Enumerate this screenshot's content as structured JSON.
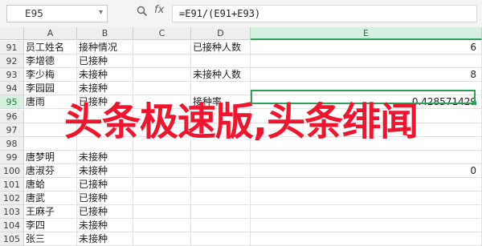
{
  "formula_bar": {
    "name_box": "E95",
    "formula": "=E91/(E91+E93)",
    "icons": [
      "zoom-icon",
      "fx-icon"
    ]
  },
  "columns": [
    "A",
    "B",
    "C",
    "D",
    "E"
  ],
  "rows": [
    {
      "num": "91",
      "a": "员工姓名",
      "b": "接种情况",
      "c": "",
      "d": "已接种人数",
      "e": "6"
    },
    {
      "num": "92",
      "a": "李增德",
      "b": "已接种",
      "c": "",
      "d": "",
      "e": ""
    },
    {
      "num": "93",
      "a": "李少梅",
      "b": "未接种",
      "c": "",
      "d": "未接种人数",
      "e": "8"
    },
    {
      "num": "94",
      "a": "李园园",
      "b": "未接种",
      "c": "",
      "d": "",
      "e": ""
    },
    {
      "num": "95",
      "a": "唐雨",
      "b": "已接种",
      "c": "",
      "d": "接种率",
      "e": "0.428571429"
    },
    {
      "num": "96",
      "a": "",
      "b": "",
      "c": "",
      "d": "",
      "e": ""
    },
    {
      "num": "97",
      "a": "",
      "b": "",
      "c": "",
      "d": "",
      "e": ""
    },
    {
      "num": "98",
      "a": "",
      "b": "",
      "c": "",
      "d": "",
      "e": ""
    },
    {
      "num": "99",
      "a": "唐梦明",
      "b": "未接种",
      "c": "",
      "d": "",
      "e": ""
    },
    {
      "num": "100",
      "a": "唐淑芬",
      "b": "未接种",
      "c": "",
      "d": "",
      "e": "0"
    },
    {
      "num": "101",
      "a": "唐蛤",
      "b": "已接种",
      "c": "",
      "d": "",
      "e": ""
    },
    {
      "num": "102",
      "a": "唐武",
      "b": "已接种",
      "c": "",
      "d": "",
      "e": ""
    },
    {
      "num": "103",
      "a": "王麻子",
      "b": "已接种",
      "c": "",
      "d": "",
      "e": ""
    },
    {
      "num": "104",
      "a": "李四",
      "b": "未接种",
      "c": "",
      "d": "",
      "e": ""
    },
    {
      "num": "105",
      "a": "张三",
      "b": "未接种",
      "c": "",
      "d": "",
      "e": ""
    }
  ],
  "selection": {
    "row": "95",
    "column": "E"
  },
  "watermark": "头条极速版,头条绯闻",
  "colors": {
    "accent": "#2ea05a",
    "watermark": "#f0142d"
  }
}
